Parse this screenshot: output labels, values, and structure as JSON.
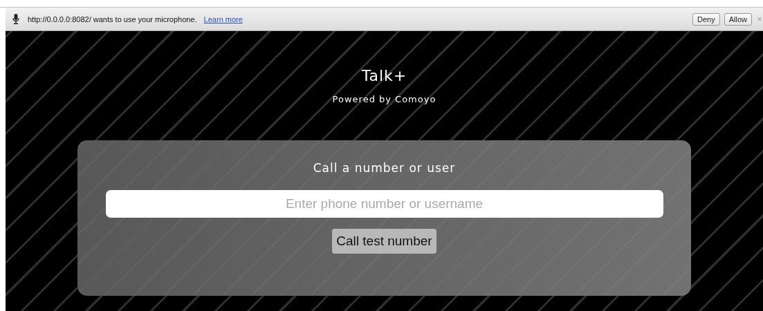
{
  "infobar": {
    "message": "http://0.0.0.0:8082/ wants to use your microphone.",
    "link": "Learn more",
    "buttons": [
      "Deny",
      "Allow"
    ],
    "close": "×"
  },
  "header": {
    "title": "Talk+",
    "subtitle": "Powered by Comoyo"
  },
  "call_card": {
    "heading": "Call a number or user",
    "input": {
      "placeholder": "Enter phone number or username"
    },
    "button": "Call test number"
  }
}
